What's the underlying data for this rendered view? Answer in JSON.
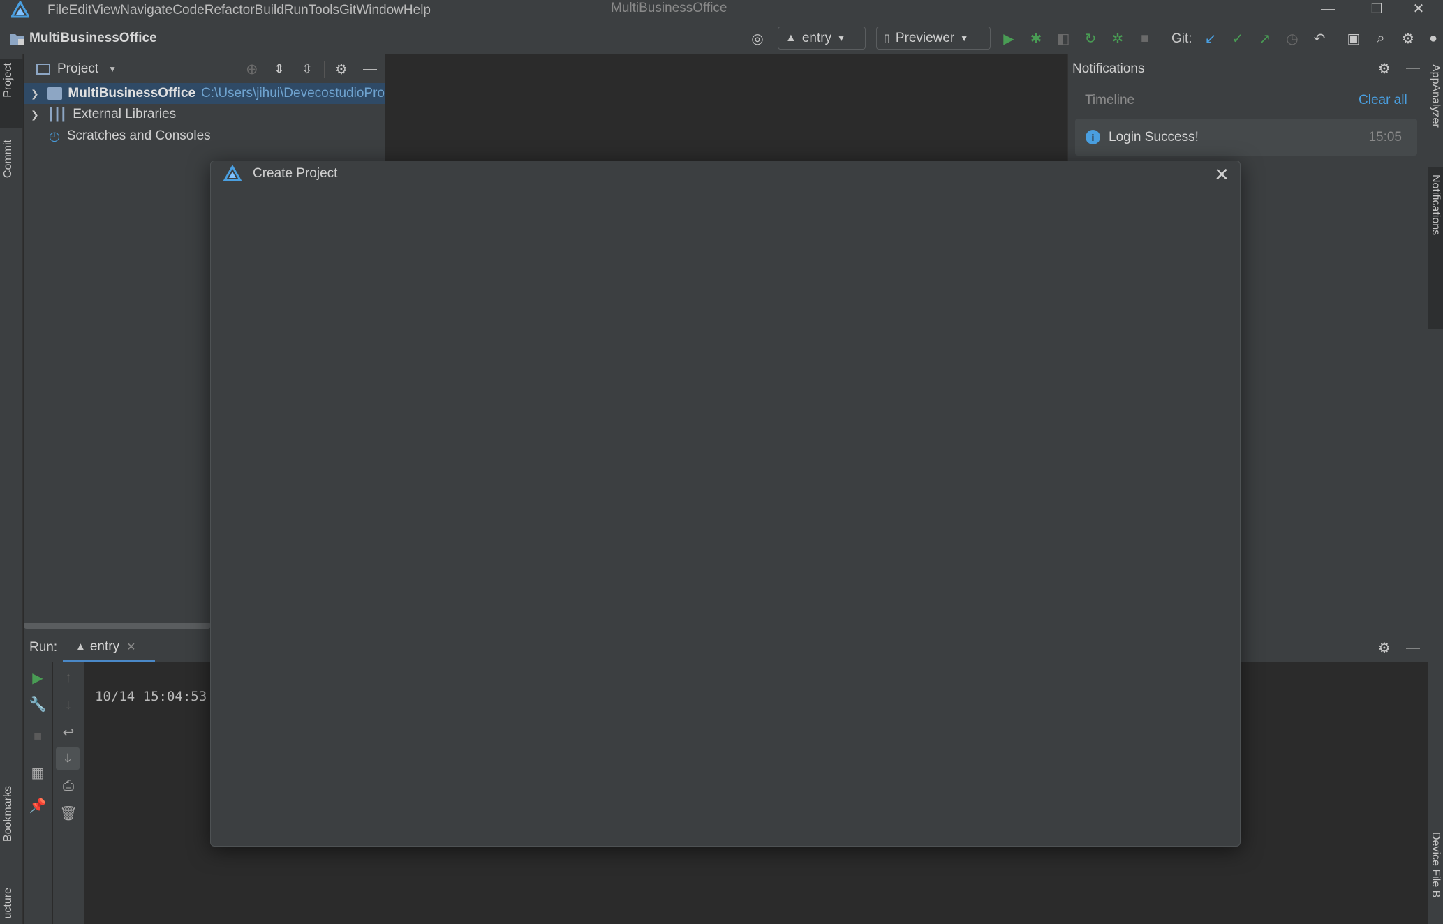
{
  "window": {
    "title": "MultiBusinessOffice",
    "controls": {
      "minimize": "—",
      "maximize": "☐",
      "close": "✕"
    }
  },
  "menu": [
    {
      "label": "File",
      "mnemonic": "F",
      "rest": "ile"
    },
    {
      "label": "Edit",
      "mnemonic": "E",
      "rest": "dit"
    },
    {
      "label": "View",
      "mnemonic": "V",
      "rest": "iew"
    },
    {
      "label": "Navigate",
      "mnemonic": "N",
      "rest": "avigate"
    },
    {
      "label": "Code",
      "mnemonic": "C",
      "rest": "ode"
    },
    {
      "label": "Refactor",
      "mnemonic": "R",
      "rest": "efactor"
    },
    {
      "label": "Build",
      "mnemonic": "B",
      "rest": "uild"
    },
    {
      "label": "Run",
      "mnemonic": "R",
      "rest": "un"
    },
    {
      "label": "Tools",
      "mnemonic": "T",
      "rest": "ools"
    },
    {
      "label": "Git",
      "mnemonic": "G",
      "rest": "it"
    },
    {
      "label": "Window",
      "mnemonic": "W",
      "rest": "indow"
    },
    {
      "label": "Help",
      "mnemonic": "H",
      "rest": "elp"
    }
  ],
  "toolbar": {
    "project_name": "MultiBusinessOffice",
    "run_config": "entry",
    "device": "Previewer",
    "git_label": "Git:"
  },
  "left_stripe": {
    "project": "Project",
    "commit": "Commit",
    "bookmarks": "Bookmarks",
    "structure": "ucture"
  },
  "right_stripe": {
    "app_analyzer": "AppAnalyzer",
    "notifications": "Notifications",
    "device_file": "Device File B"
  },
  "project_panel": {
    "title": "Project",
    "tree": [
      {
        "label": "MultiBusinessOffice",
        "path": "C:\\Users\\jihui\\DevecostudioPro"
      },
      {
        "label": "External Libraries"
      },
      {
        "label": "Scratches and Consoles"
      }
    ]
  },
  "notifications": {
    "title": "Notifications",
    "timeline": "Timeline",
    "clear_all": "Clear all",
    "items": [
      {
        "message": "Login Success!",
        "time": "15:05"
      }
    ]
  },
  "run_panel": {
    "label": "Run:",
    "tab": "entry",
    "console_line": "10/14 15:04:53"
  },
  "modal": {
    "title": "Create Project"
  },
  "colors": {
    "accent_blue": "#4a9fe0",
    "run_green": "#499c54",
    "selection": "#2f4a66"
  }
}
